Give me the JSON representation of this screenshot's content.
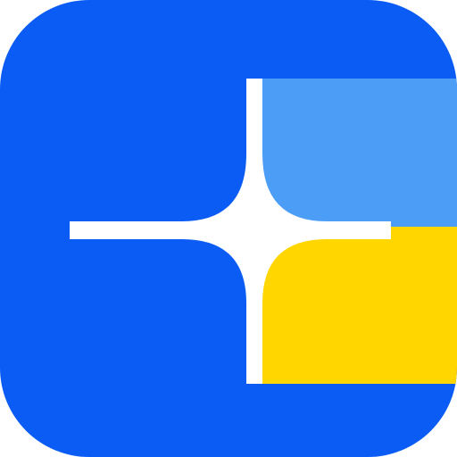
{
  "app_icon": {
    "icon_name": "sparkle-panel-app-icon",
    "colors": {
      "background": "#0A5CF5",
      "top_right_panel": "#4B9DF6",
      "bottom_right_panel": "#FFD600",
      "sparkle": "#FFFFFF"
    }
  }
}
